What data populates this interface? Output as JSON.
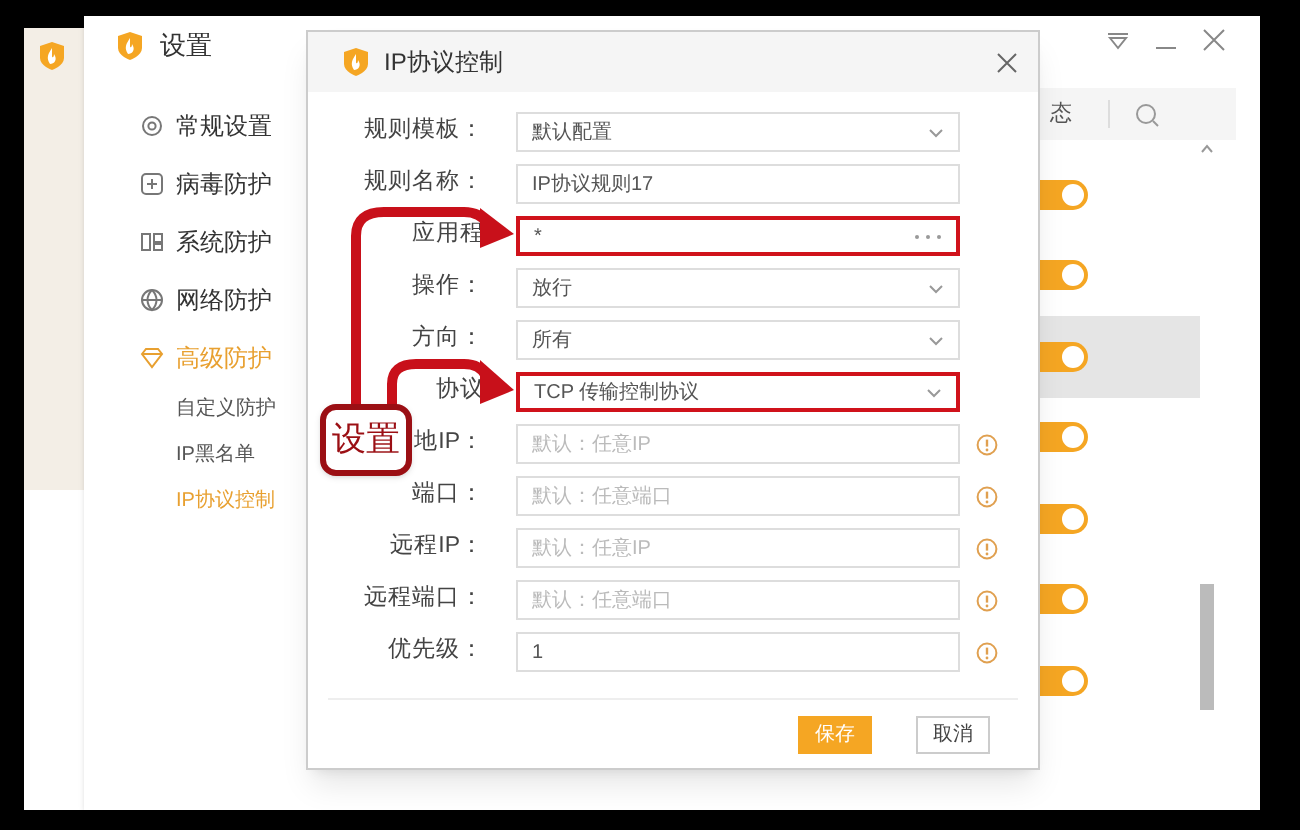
{
  "window": {
    "title": "设置"
  },
  "sidebar": {
    "items": [
      {
        "label": "常规设置",
        "selected": false
      },
      {
        "label": "病毒防护",
        "selected": false
      },
      {
        "label": "系统防护",
        "selected": false
      },
      {
        "label": "网络防护",
        "selected": false
      },
      {
        "label": "高级防护",
        "selected": true,
        "children": [
          {
            "label": "自定义防护",
            "selected": false
          },
          {
            "label": "IP黑名单",
            "selected": false
          },
          {
            "label": "IP协议控制",
            "selected": true
          }
        ]
      }
    ]
  },
  "list_panel": {
    "column_header": "态",
    "rows": [
      {
        "on": true,
        "selected": false
      },
      {
        "on": true,
        "selected": false
      },
      {
        "on": true,
        "selected": true
      },
      {
        "on": true,
        "selected": false
      },
      {
        "on": true,
        "selected": false
      },
      {
        "on": true,
        "selected": false
      },
      {
        "on": true,
        "selected": false
      }
    ]
  },
  "dialog": {
    "title": "IP协议控制",
    "fields": [
      {
        "label": "规则模板：",
        "kind": "select",
        "value": "默认配置",
        "info": false,
        "highlighted": false
      },
      {
        "label": "规则名称：",
        "kind": "text",
        "value": "IP协议规则17",
        "info": false,
        "highlighted": false
      },
      {
        "label": "应用程",
        "kind": "browse",
        "value": "*",
        "info": false,
        "highlighted": true
      },
      {
        "label": "操作：",
        "kind": "select",
        "value": "放行",
        "info": false,
        "highlighted": false
      },
      {
        "label": "方向：",
        "kind": "select",
        "value": "所有",
        "info": false,
        "highlighted": false
      },
      {
        "label": "协议",
        "kind": "select",
        "value": "TCP 传输控制协议",
        "info": false,
        "highlighted": true
      },
      {
        "label": "地IP：",
        "kind": "text",
        "placeholder": "默认：任意IP",
        "info": true,
        "highlighted": false
      },
      {
        "label": "端口：",
        "kind": "text",
        "placeholder": "默认：任意端口",
        "info": true,
        "highlighted": false
      },
      {
        "label": "远程IP：",
        "kind": "text",
        "placeholder": "默认：任意IP",
        "info": true,
        "highlighted": false
      },
      {
        "label": "远程端口：",
        "kind": "text",
        "placeholder": "默认：任意端口",
        "info": true,
        "highlighted": false
      },
      {
        "label": "优先级：",
        "kind": "text",
        "value": "1",
        "info": true,
        "highlighted": false
      }
    ],
    "buttons": [
      {
        "label": "保存",
        "primary": true
      },
      {
        "label": "取消",
        "primary": false
      }
    ]
  },
  "annotation": {
    "callout": "设置"
  }
}
